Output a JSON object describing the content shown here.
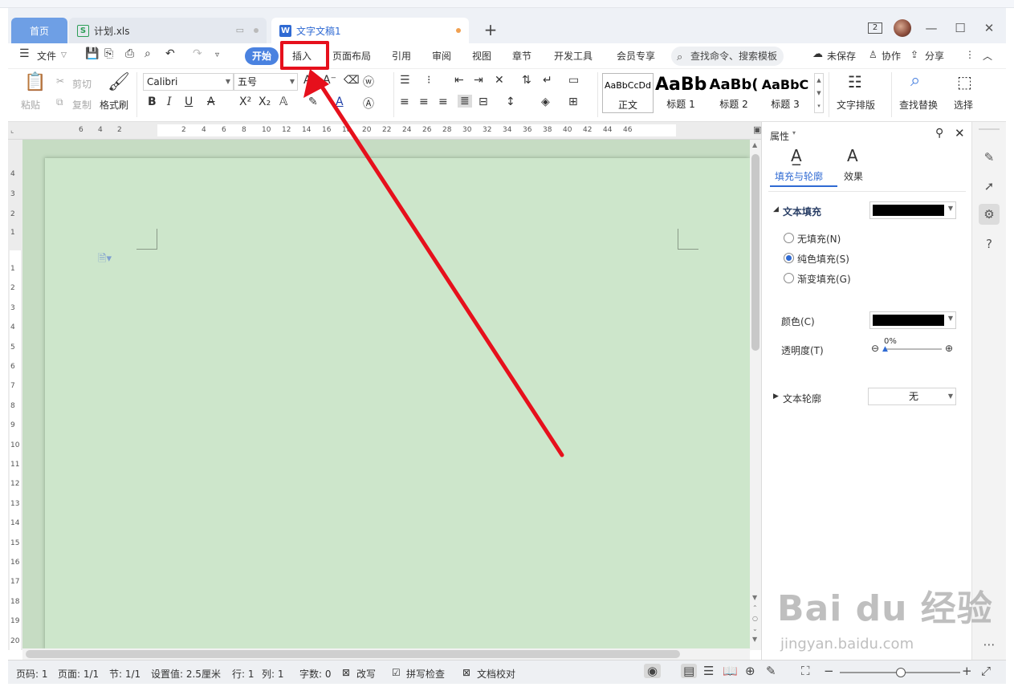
{
  "tabs": {
    "home": "首页",
    "xls": "计划.xls",
    "doc": "文字文稿1",
    "add": "+"
  },
  "window": {
    "badge": "2",
    "minimize": "—",
    "maximize": "☐",
    "close": "✕"
  },
  "menu": {
    "file": "文件",
    "start": "开始",
    "insert": "插入",
    "layout": "页面布局",
    "ref": "引用",
    "review": "审阅",
    "view": "视图",
    "chapter": "章节",
    "dev": "开发工具",
    "member": "会员专享",
    "search": "查找命令、搜索模板",
    "unsaved": "未保存",
    "collab": "协作",
    "share": "分享"
  },
  "ribbon": {
    "paste": "粘贴",
    "cut": "剪切",
    "copy": "复制",
    "format_painter": "格式刷",
    "font_name": "Calibri",
    "font_size": "五号",
    "styles": [
      {
        "sample": "AaBbCcDd",
        "name": "正文"
      },
      {
        "sample": "AaBb",
        "name": "标题 1"
      },
      {
        "sample": "AaBb(",
        "name": "标题 2"
      },
      {
        "sample": "AaBbC",
        "name": "标题 3"
      }
    ],
    "text_layout": "文字排版",
    "find_replace": "查找替换",
    "select": "选择"
  },
  "ruler": {
    "h_ticks": [
      "6",
      "4",
      "2",
      "2",
      "4",
      "6",
      "8",
      "10",
      "12",
      "14",
      "16",
      "18",
      "20",
      "22",
      "24",
      "26",
      "28",
      "30",
      "32",
      "34",
      "36",
      "38",
      "40",
      "42",
      "44",
      "46"
    ],
    "v_ticks_top": [
      "4",
      "3",
      "2",
      "1"
    ],
    "v_ticks": [
      "1",
      "2",
      "3",
      "4",
      "5",
      "6",
      "7",
      "8",
      "9",
      "10",
      "11",
      "12",
      "13",
      "14",
      "15",
      "16",
      "17",
      "18",
      "19",
      "20"
    ]
  },
  "properties": {
    "title": "属性",
    "tab_fill": "填充与轮廓",
    "tab_effect": "效果",
    "text_fill": "文本填充",
    "no_fill": "无填充(N)",
    "solid_fill": "纯色填充(S)",
    "gradient_fill": "渐变填充(G)",
    "color": "颜色(C)",
    "transparency": "透明度(T)",
    "transparency_value": "0%",
    "text_outline": "文本轮廓",
    "outline_value": "无",
    "fill_color": "#000000"
  },
  "status": {
    "page_code": "页码: 1",
    "pages": "页面: 1/1",
    "section": "节: 1/1",
    "setting": "设置值: 2.5厘米",
    "row": "行: 1",
    "col": "列: 1",
    "word_count": "字数: 0",
    "revise": "改写",
    "spell": "拼写检查",
    "proof": "文档校对"
  },
  "watermark": {
    "logo": "Bai du 经验",
    "url": "jingyan.baidu.com"
  },
  "colors": {
    "accent": "#2f6ad3",
    "highlight": "#e6101c",
    "page_bg": "#cde6cb"
  }
}
